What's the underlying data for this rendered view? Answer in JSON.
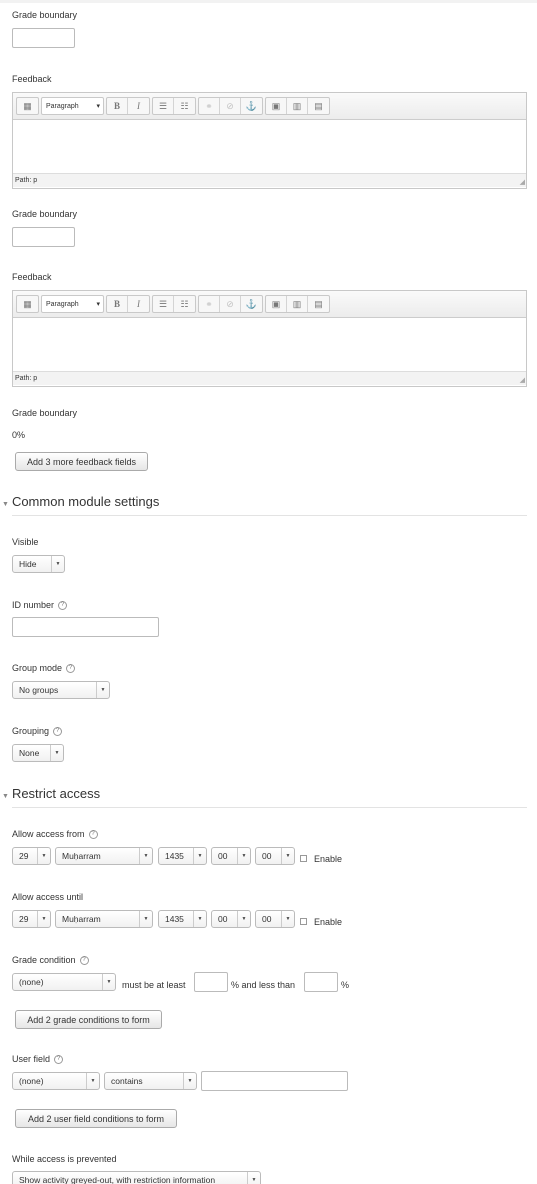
{
  "feedback_blocks": [
    {
      "grade_boundary_label": "Grade boundary",
      "feedback_label": "Feedback"
    },
    {
      "grade_boundary_label": "Grade boundary",
      "feedback_label": "Feedback"
    }
  ],
  "editor": {
    "paragraph_select": "Paragraph",
    "path_text": "Path: p",
    "bold": "B",
    "italic": "I",
    "grip": "◢"
  },
  "last_boundary": {
    "label": "Grade boundary",
    "value": "0%"
  },
  "add_feedback_button": "Add 3 more feedback fields",
  "common_module": {
    "title": "Common module settings",
    "visible_label": "Visible",
    "visible_value": "Hide",
    "id_number_label": "ID number",
    "group_mode_label": "Group mode",
    "group_mode_value": "No groups",
    "grouping_label": "Grouping",
    "grouping_value": "None"
  },
  "restrict_access": {
    "title": "Restrict access",
    "allow_from": {
      "label": "Allow access from",
      "day": "29",
      "month": "Muḥarram",
      "year": "1435",
      "hour": "00",
      "minute": "00",
      "enable": "Enable"
    },
    "allow_until": {
      "label": "Allow access until",
      "day": "29",
      "month": "Muḥarram",
      "year": "1435",
      "hour": "00",
      "minute": "00",
      "enable": "Enable"
    },
    "grade_condition": {
      "label": "Grade condition",
      "value": "(none)",
      "must_be": "must be at least",
      "and_less": "% and less than",
      "pct": "%",
      "button": "Add 2 grade conditions to form"
    },
    "user_field": {
      "label": "User field",
      "field_value": "(none)",
      "operator_value": "contains",
      "button": "Add 2 user field conditions to form"
    },
    "while_prevented": {
      "label": "While access is prevented",
      "value": "Show activity greyed-out, with restriction information"
    }
  },
  "icons": {
    "help": "?",
    "section_toggle": "▼",
    "dropdown": "▼"
  }
}
